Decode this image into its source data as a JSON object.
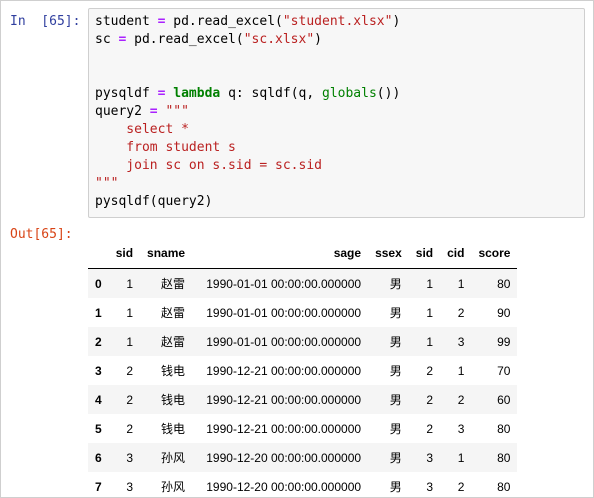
{
  "cell": {
    "in_prompt": "In  [65]:",
    "out_prompt": "Out[65]:",
    "code_lines": [
      [
        {
          "t": "student "
        },
        {
          "t": "=",
          "c": "op"
        },
        {
          "t": " pd.read_excel("
        },
        {
          "t": "\"student.xlsx\"",
          "c": "str"
        },
        {
          "t": ")"
        }
      ],
      [
        {
          "t": "sc "
        },
        {
          "t": "=",
          "c": "op"
        },
        {
          "t": " pd.read_excel("
        },
        {
          "t": "\"sc.xlsx\"",
          "c": "str"
        },
        {
          "t": ")"
        }
      ],
      [
        {
          "t": ""
        }
      ],
      [
        {
          "t": ""
        }
      ],
      [
        {
          "t": "pysqldf "
        },
        {
          "t": "=",
          "c": "op"
        },
        {
          "t": " "
        },
        {
          "t": "lambda",
          "c": "kw"
        },
        {
          "t": " q: sqldf(q, "
        },
        {
          "t": "globals",
          "c": "builtin"
        },
        {
          "t": "())"
        }
      ],
      [
        {
          "t": "query2 "
        },
        {
          "t": "=",
          "c": "op"
        },
        {
          "t": " "
        },
        {
          "t": "\"\"\"",
          "c": "str"
        }
      ],
      [
        {
          "t": "    select *",
          "c": "sql"
        }
      ],
      [
        {
          "t": "    from student s",
          "c": "sql"
        }
      ],
      [
        {
          "t": "    join sc on s.sid = sc.sid",
          "c": "sql"
        }
      ],
      [
        {
          "t": "\"\"\"",
          "c": "str"
        }
      ],
      [
        {
          "t": "pysqldf(query2)"
        }
      ]
    ]
  },
  "dataframe": {
    "columns": [
      "",
      "sid",
      "sname",
      "sage",
      "ssex",
      "sid",
      "cid",
      "score"
    ],
    "rows": [
      [
        "0",
        "1",
        "赵雷",
        "1990-01-01 00:00:00.000000",
        "男",
        "1",
        "1",
        "80"
      ],
      [
        "1",
        "1",
        "赵雷",
        "1990-01-01 00:00:00.000000",
        "男",
        "1",
        "2",
        "90"
      ],
      [
        "2",
        "1",
        "赵雷",
        "1990-01-01 00:00:00.000000",
        "男",
        "1",
        "3",
        "99"
      ],
      [
        "3",
        "2",
        "钱电",
        "1990-12-21 00:00:00.000000",
        "男",
        "2",
        "1",
        "70"
      ],
      [
        "4",
        "2",
        "钱电",
        "1990-12-21 00:00:00.000000",
        "男",
        "2",
        "2",
        "60"
      ],
      [
        "5",
        "2",
        "钱电",
        "1990-12-21 00:00:00.000000",
        "男",
        "2",
        "3",
        "80"
      ],
      [
        "6",
        "3",
        "孙风",
        "1990-12-20 00:00:00.000000",
        "男",
        "3",
        "1",
        "80"
      ],
      [
        "7",
        "3",
        "孙风",
        "1990-12-20 00:00:00.000000",
        "男",
        "3",
        "2",
        "80"
      ]
    ]
  }
}
